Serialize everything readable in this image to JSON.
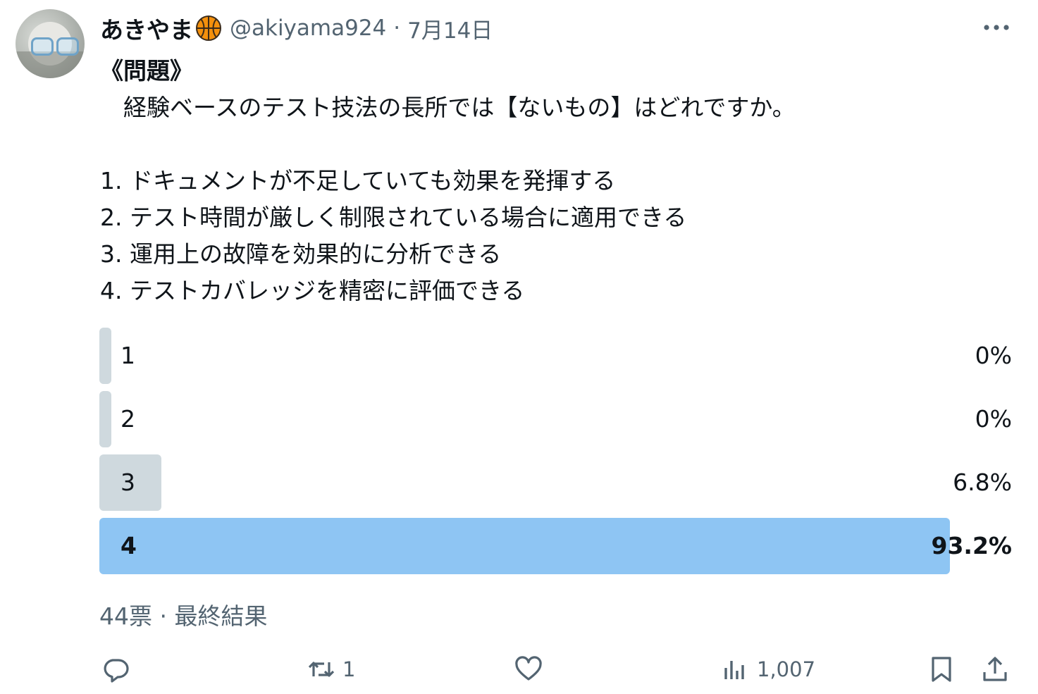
{
  "tweet": {
    "author_name": "あきやま",
    "handle": "@akiyama924",
    "separator": "·",
    "date": "7月14日",
    "title": "《問題》",
    "question": "　経験ベースのテスト技法の長所では【ないもの】はどれですか。",
    "choices": [
      "1. ドキュメントが不足していても効果を発揮する",
      "2. テスト時間が厳しく制限されている場合に適用できる",
      "3. 運用上の故障を効果的に分析できる",
      "4. テストカバレッジを精密に評価できる"
    ]
  },
  "poll": {
    "options": [
      {
        "label": "1",
        "percent_text": "0%",
        "percent": 0,
        "winner": false
      },
      {
        "label": "2",
        "percent_text": "0%",
        "percent": 0,
        "winner": false
      },
      {
        "label": "3",
        "percent_text": "6.8%",
        "percent": 6.8,
        "winner": false
      },
      {
        "label": "4",
        "percent_text": "93.2%",
        "percent": 93.2,
        "winner": true
      }
    ],
    "votes": "44票",
    "status": "最終結果"
  },
  "actions": {
    "reply_count": "",
    "retweet_count": "1",
    "like_count": "",
    "views_count": "1,007"
  },
  "colors": {
    "text": "#0f1419",
    "muted": "#536471",
    "bar": "#cfd9de",
    "bar_winner": "#8ec5f3"
  },
  "icons": [
    "basketball-icon",
    "more-icon",
    "reply-icon",
    "retweet-icon",
    "like-icon",
    "views-icon",
    "bookmark-icon",
    "share-icon"
  ]
}
